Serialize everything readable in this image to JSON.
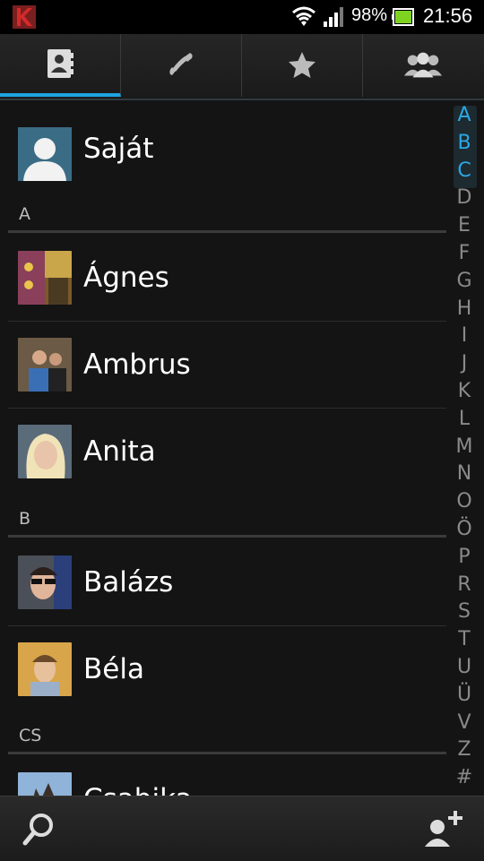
{
  "status_bar": {
    "battery_percent": "98%",
    "time": "21:56",
    "icons": [
      "kaspersky-icon",
      "wifi-icon",
      "signal-icon",
      "battery-icon"
    ]
  },
  "tabs": [
    {
      "name": "contacts",
      "icon": "contact-card-icon",
      "active": true
    },
    {
      "name": "phone",
      "icon": "phone-icon",
      "active": false
    },
    {
      "name": "favorites",
      "icon": "star-icon",
      "active": false
    },
    {
      "name": "groups",
      "icon": "group-icon",
      "active": false
    }
  ],
  "own_profile": {
    "name": "Saját"
  },
  "sections": [
    {
      "header": "A",
      "contacts": [
        {
          "name": "Ágnes"
        },
        {
          "name": "Ambrus"
        },
        {
          "name": "Anita"
        }
      ]
    },
    {
      "header": "B",
      "contacts": [
        {
          "name": "Balázs"
        },
        {
          "name": "Béla"
        }
      ]
    },
    {
      "header": "CS",
      "contacts": [
        {
          "name": "Csabika"
        }
      ]
    }
  ],
  "index_letters": [
    "A",
    "B",
    "C",
    "D",
    "E",
    "F",
    "G",
    "H",
    "I",
    "J",
    "K",
    "L",
    "M",
    "N",
    "O",
    "Ö",
    "P",
    "R",
    "S",
    "T",
    "U",
    "Ü",
    "V",
    "Z",
    "#"
  ],
  "index_active": [
    "A",
    "B",
    "C"
  ],
  "bottom_bar": {
    "icons": [
      "search-icon",
      "add-contact-icon"
    ]
  },
  "colors": {
    "accent": "#1ea3e0",
    "background": "#141414"
  }
}
